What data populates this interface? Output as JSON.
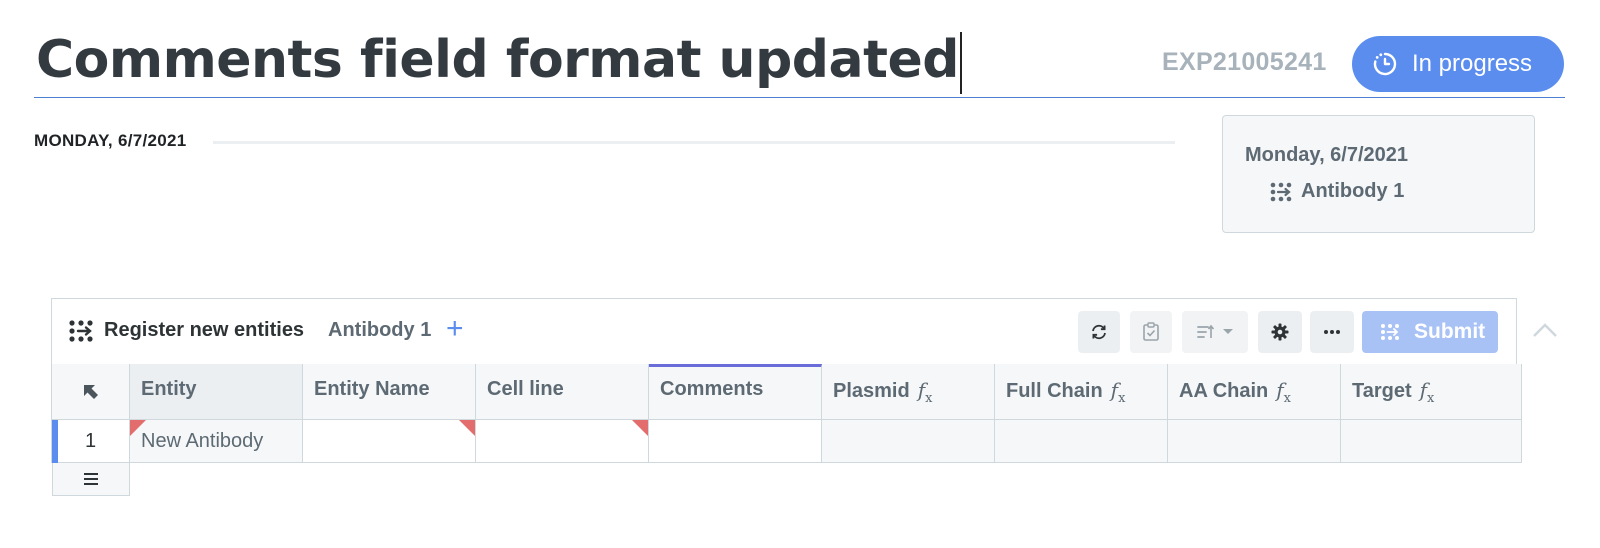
{
  "header": {
    "title": "Comments field format updated",
    "experiment_id": "EXP21005241",
    "status_label": "In progress"
  },
  "entry": {
    "date_label": "MONDAY, 6/7/2021"
  },
  "side_card": {
    "date": "Monday, 6/7/2021",
    "entity": "Antibody 1"
  },
  "panel": {
    "title": "Register new entities",
    "entity_tab": "Antibody 1",
    "add_symbol": "+",
    "submit_label": "Submit"
  },
  "table": {
    "columns": [
      {
        "label": "Entity",
        "formula": false
      },
      {
        "label": "Entity Name",
        "formula": false
      },
      {
        "label": "Cell line",
        "formula": false
      },
      {
        "label": "Comments",
        "formula": false
      },
      {
        "label": "Plasmid",
        "formula": true
      },
      {
        "label": "Full Chain",
        "formula": true
      },
      {
        "label": "AA Chain",
        "formula": true
      },
      {
        "label": "Target",
        "formula": true
      }
    ],
    "formula_symbol": "f",
    "formula_sub": "x",
    "rows": [
      {
        "number": "1",
        "cells": [
          "New Antibody",
          "",
          "",
          "",
          "",
          "",
          "",
          ""
        ]
      }
    ]
  },
  "colors": {
    "accent": "#5b8def",
    "submit_disabled": "#a9c2f5",
    "required_flag": "#e36d6d",
    "active_column": "#6a6cd8"
  }
}
